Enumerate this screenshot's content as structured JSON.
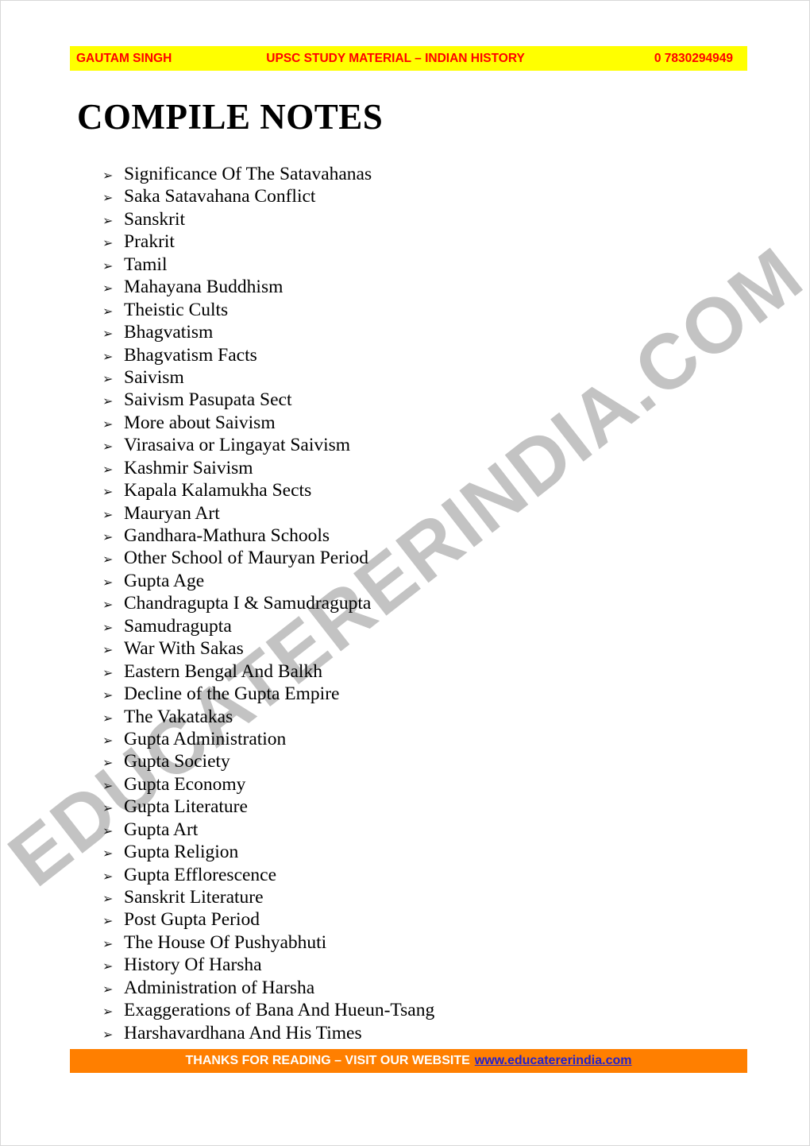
{
  "header": {
    "left": "GAUTAM SINGH",
    "center": "UPSC STUDY MATERIAL – INDIAN HISTORY",
    "right": "0 7830294949",
    "background_color": "#ffff00",
    "text_color": "#ff0000"
  },
  "title": "COMPILE NOTES",
  "watermark": {
    "text": "EDUCATERERINDIA.COM",
    "color": "#c3c3c3",
    "rotation_deg": -38
  },
  "bullet_glyph": "➢",
  "notes": [
    "Significance Of The Satavahanas",
    "Saka Satavahana Conflict",
    "Sanskrit",
    "Prakrit",
    "Tamil",
    "Mahayana Buddhism",
    "Theistic Cults",
    "Bhagvatism",
    "Bhagvatism Facts",
    "Saivism",
    "Saivism Pasupata Sect",
    "More about Saivism",
    "Virasaiva or Lingayat Saivism",
    "Kashmir Saivism",
    "Kapala Kalamukha Sects",
    "Mauryan Art",
    "Gandhara-Mathura Schools",
    "Other School of Mauryan Period",
    "Gupta Age",
    "Chandragupta I & Samudragupta",
    "Samudragupta",
    "War With Sakas",
    "Eastern Bengal And Balkh",
    "Decline of the Gupta Empire",
    "The Vakatakas",
    "Gupta Administration",
    "Gupta Society",
    "Gupta Economy",
    "Gupta Literature",
    "Gupta Art",
    "Gupta Religion",
    "Gupta Efflorescence",
    "Sanskrit Literature",
    "Post Gupta Period",
    "The House Of Pushyabhuti",
    "History Of Harsha",
    "Administration of Harsha",
    "Exaggerations of Bana And Hueun-Tsang",
    "Harshavardhana And His Times"
  ],
  "footer": {
    "message": "THANKS FOR READING – VISIT OUR WEBSITE",
    "url": "www.educatererindia.com",
    "background_color": "#ff7f00",
    "text_color": "#ffffff",
    "url_color": "#2222cc"
  }
}
